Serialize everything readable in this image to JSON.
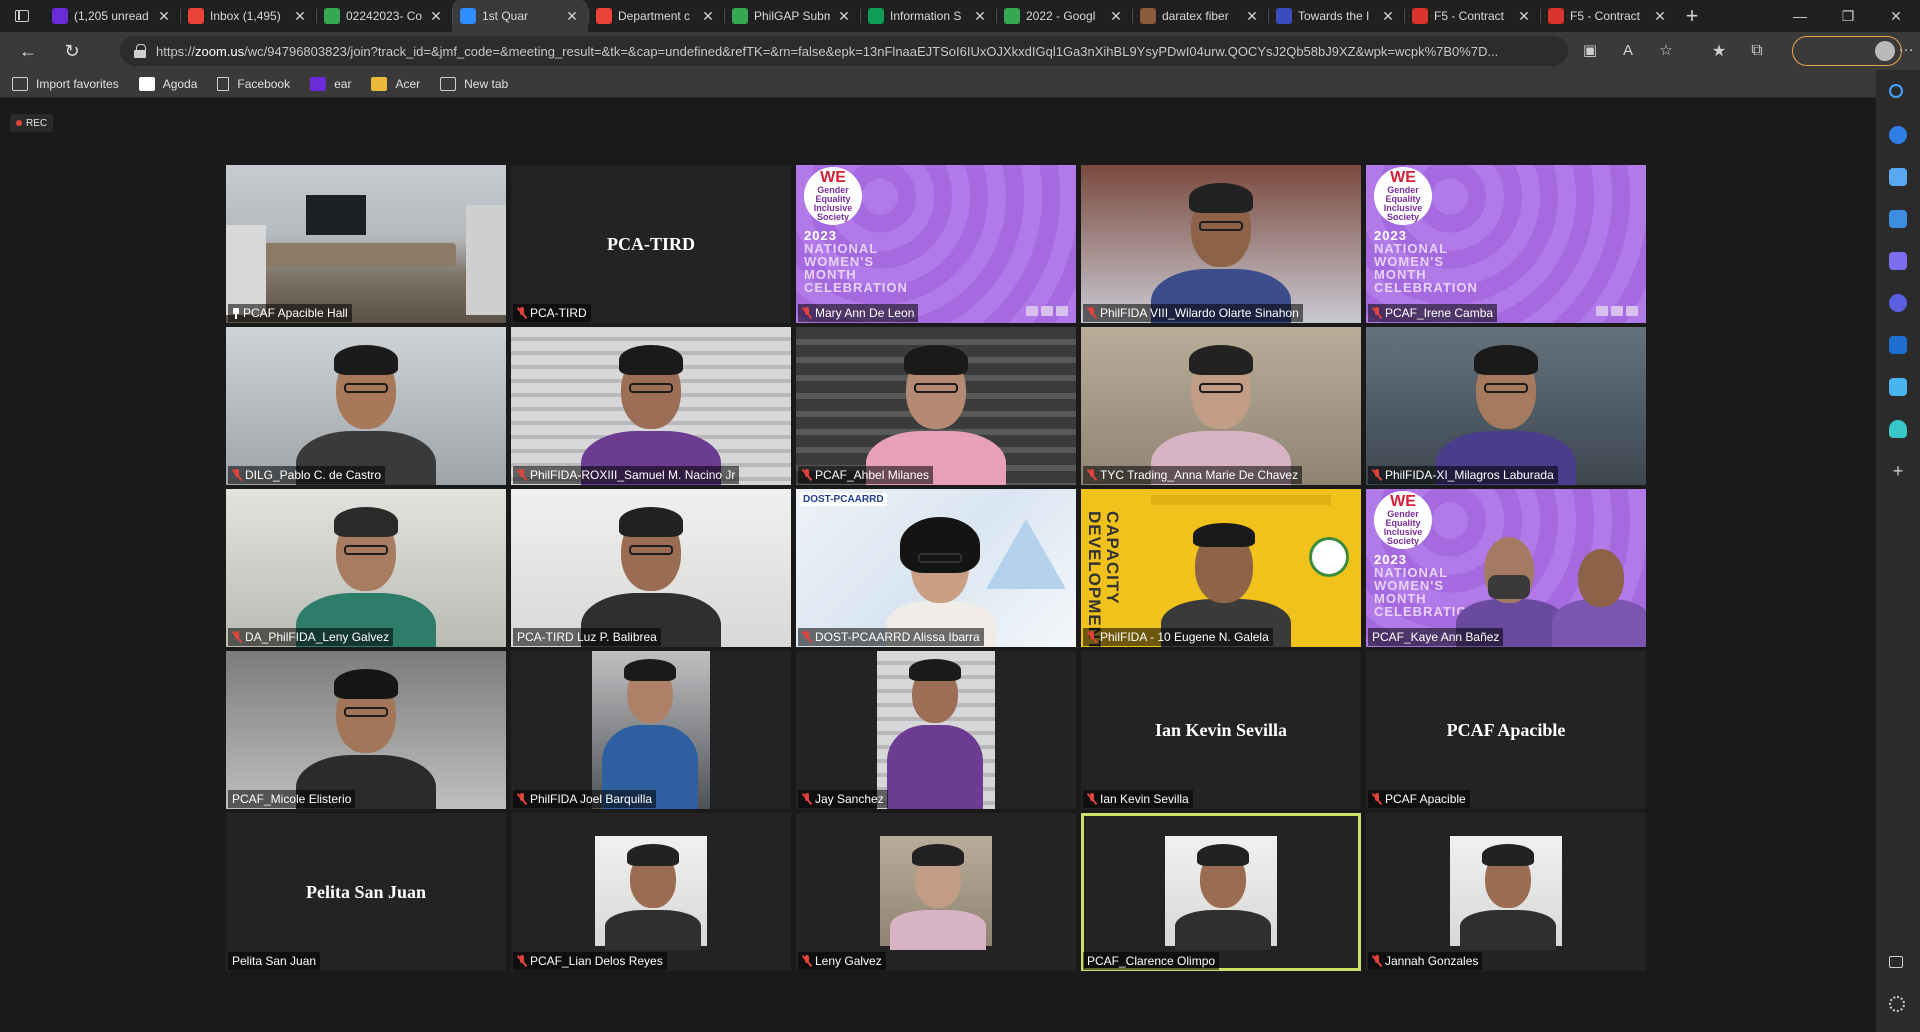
{
  "browser": {
    "tabs": [
      {
        "label": "(1,205 unread",
        "favicon": "yahoo-mail-icon",
        "color": "#6a2bd8",
        "active": false
      },
      {
        "label": "Inbox (1,495)",
        "favicon": "gmail-icon",
        "color": "#ea4335",
        "active": false
      },
      {
        "label": "02242023- Co",
        "favicon": "google-drive-icon",
        "color": "#34a853",
        "active": false
      },
      {
        "label": "1st Quar",
        "favicon": "zoom-icon",
        "color": "#2d8cff",
        "active": true
      },
      {
        "label": "Department c",
        "favicon": "gmail-icon",
        "color": "#ea4335",
        "active": false
      },
      {
        "label": "PhilGAP Subm",
        "favicon": "google-drive-icon",
        "color": "#34a853",
        "active": false
      },
      {
        "label": "Information S",
        "favicon": "google-sheets-icon",
        "color": "#0f9d58",
        "active": false
      },
      {
        "label": "2022 - Googl",
        "favicon": "google-drive-icon",
        "color": "#34a853",
        "active": false
      },
      {
        "label": "daratex fiber",
        "favicon": "site-icon",
        "color": "#8a5a3c",
        "active": false
      },
      {
        "label": "Towards the I",
        "favicon": "document-icon",
        "color": "#3b4cc0",
        "active": false
      },
      {
        "label": "F5 - Contract",
        "favicon": "pdf-icon",
        "color": "#d9342b",
        "active": false
      },
      {
        "label": "F5 - Contract",
        "favicon": "pdf-icon",
        "color": "#d9342b",
        "active": false
      }
    ],
    "url_prefix": "https://",
    "url_host": "zoom.us",
    "url_rest": "/wc/94796803823/join?track_id=&jmf_code=&meeting_result=&tk=&cap=undefined&refTK=&rn=false&epk=13nFlnaaEJTSoI6IUxOJXkxdIGql1Ga3nXihBL9YsyPDwI04urw.QOCYsJ2Qb58bJ9XZ&wpk=wcpk%7B0%7D...",
    "favorites": [
      {
        "label": "Import favorites",
        "icon": "import-icon"
      },
      {
        "label": "Agoda",
        "icon": "agoda-icon"
      },
      {
        "label": "Facebook",
        "icon": "page-icon"
      },
      {
        "label": "ear",
        "icon": "yahoo-icon"
      },
      {
        "label": "Acer",
        "icon": "folder-icon"
      },
      {
        "label": "New tab",
        "icon": "newtab-icon"
      }
    ]
  },
  "meeting": {
    "rec_label": "REC",
    "participants": [
      {
        "name": "PCAF Apacible Hall",
        "icon": "pin",
        "kind": "room"
      },
      {
        "name": "PCA-TIRD",
        "icon": "mic-off",
        "kind": "name-only"
      },
      {
        "name": "Mary Ann De Leon",
        "icon": "mic-off",
        "kind": "poster"
      },
      {
        "name": "PhilFIDA VIII_Wilardo Olarte Sinahon",
        "icon": "mic-off",
        "kind": "video"
      },
      {
        "name": "PCAF_Irene Camba",
        "icon": "mic-off",
        "kind": "poster"
      },
      {
        "name": "DILG_Pablo C. de Castro",
        "icon": "mic-off",
        "kind": "video"
      },
      {
        "name": "PhilFIDA-ROXIII_Samuel M. Nacino Jr",
        "icon": "mic-off",
        "kind": "video"
      },
      {
        "name": "PCAF_Ahbel Milanes",
        "icon": "mic-off",
        "kind": "video"
      },
      {
        "name": "TYC Trading_Anna Marie De Chavez",
        "icon": "mic-off",
        "kind": "video"
      },
      {
        "name": "PhilFIDA-XI_Milagros Laburada",
        "icon": "mic-off",
        "kind": "video"
      },
      {
        "name": "DA_PhilFIDA_Leny Galvez",
        "icon": "mic-off",
        "kind": "video"
      },
      {
        "name": "PCA-TIRD Luz P. Balibrea",
        "icon": "none",
        "kind": "video"
      },
      {
        "name": "DOST-PCAARRD Alissa Ibarra",
        "icon": "mic-off",
        "kind": "video-poly"
      },
      {
        "name": "PhilFIDA - 10 Eugene N. Galela",
        "icon": "mic-off",
        "kind": "video-yellow"
      },
      {
        "name": "PCAF_Kaye Ann Bañez",
        "icon": "none",
        "kind": "poster-people"
      },
      {
        "name": "PCAF_Micole Elisterio",
        "icon": "none",
        "kind": "video"
      },
      {
        "name": "PhilFIDA Joel Barquilla",
        "icon": "mic-off",
        "kind": "photo"
      },
      {
        "name": "Jay Sanchez",
        "icon": "mic-off",
        "kind": "photo"
      },
      {
        "name": "Ian Kevin Sevilla",
        "icon": "mic-off",
        "kind": "name-only"
      },
      {
        "name": "PCAF Apacible",
        "icon": "mic-off",
        "kind": "name-only"
      },
      {
        "name": "Pelita San Juan",
        "icon": "none",
        "kind": "name-only"
      },
      {
        "name": "PCAF_Lian Delos Reyes",
        "icon": "mic-off",
        "kind": "photo-small"
      },
      {
        "name": "Leny Galvez",
        "icon": "mic-off",
        "kind": "photo-small"
      },
      {
        "name": "PCAF_Clarence Olimpo",
        "icon": "none",
        "kind": "photo-small",
        "speaking": true
      },
      {
        "name": "Jannah Gonzales",
        "icon": "mic-off",
        "kind": "photo-small"
      }
    ],
    "poster": {
      "we": "WE",
      "line1": "Gender",
      "line2": "Equality",
      "line3": "Inclusive",
      "line4": "Society",
      "year": "2023",
      "title1": "NATIONAL",
      "title2": "WOMEN'S",
      "title3": "MONTH",
      "title4": "CELEBRATION"
    },
    "yellow_text": "CAPACITY DEVELOPMENT",
    "dost_tag": "DOST-PCAARRD"
  },
  "colors": {
    "speaking_outline": "#c9e36a",
    "mic_off": "#e0443c"
  }
}
